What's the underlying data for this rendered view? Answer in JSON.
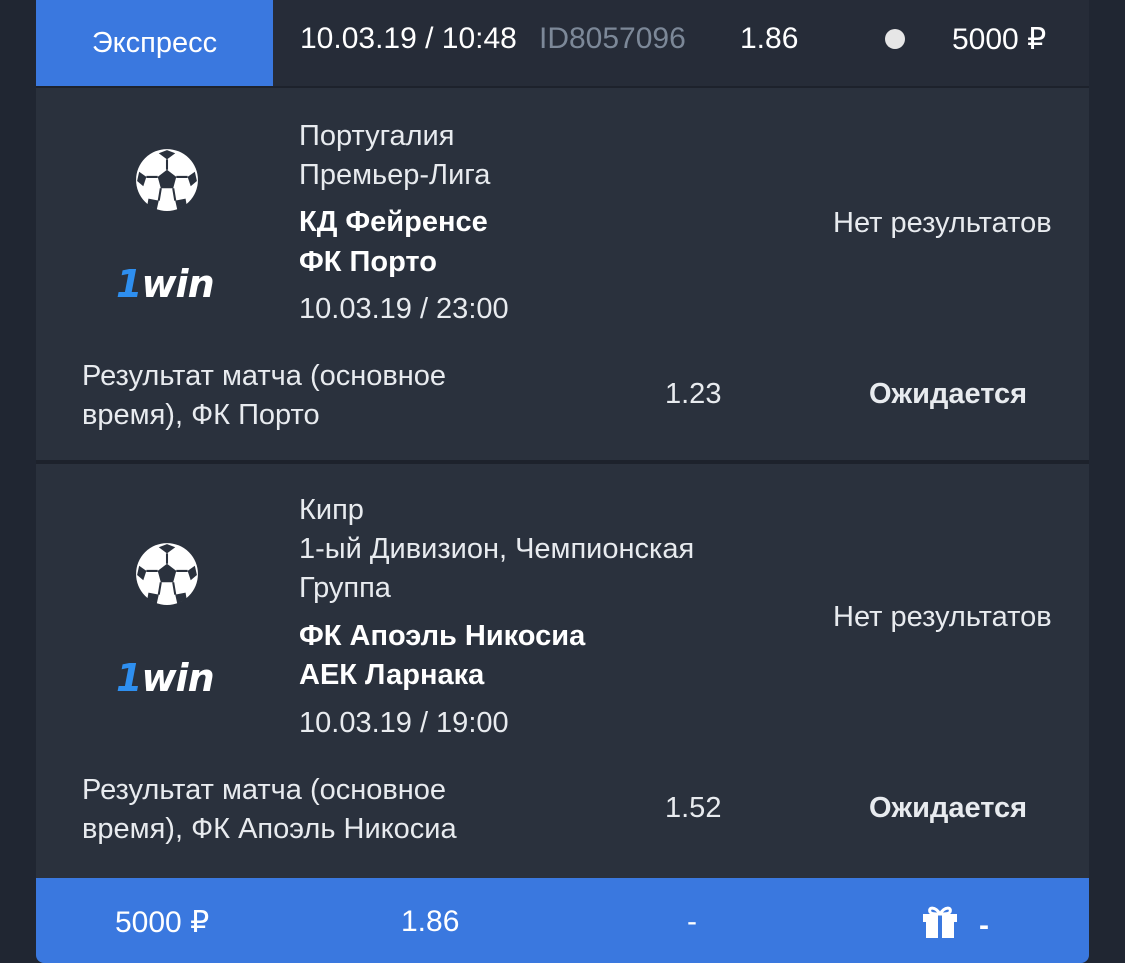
{
  "header": {
    "type_label": "Экспресс",
    "datetime": "10.03.19 / 10:48",
    "bet_id": "ID8057096",
    "coefficient": "1.86",
    "amount": "5000 ₽"
  },
  "events": [
    {
      "country": "Португалия",
      "league_line1": "Премьер-Лига",
      "league_line2": "",
      "team1": "КД Фейренсе",
      "team2": "ФК Порто",
      "datetime": "10.03.19 / 23:00",
      "result": "Нет результатов",
      "market_line1": "Результат матча (основное",
      "market_line2": "время), ФК Порто",
      "odd": "1.23",
      "status": "Ожидается",
      "sport_icon": "soccer-ball-icon",
      "brand_logo": "1win"
    },
    {
      "country": "Кипр",
      "league_line1": "1-ый Дивизион, Чемпионская",
      "league_line2": "Группа",
      "team1": "ФК Апоэль Никосиа",
      "team2": "АЕК Ларнака",
      "datetime": "10.03.19 / 19:00",
      "result": "Нет результатов",
      "market_line1": "Результат матча (основное",
      "market_line2": "время), ФК Апоэль Никосиа",
      "odd": "1.52",
      "status": "Ожидается",
      "sport_icon": "soccer-ball-icon",
      "brand_logo": "1win"
    }
  ],
  "footer": {
    "amount": "5000 ₽",
    "coefficient": "1.86",
    "payout": "-",
    "bonus": "-",
    "gift_icon": "gift-icon"
  },
  "colors": {
    "accent": "#3a78df",
    "card_bg": "#2a313d",
    "page_bg": "#202632",
    "muted_text": "#7c8898",
    "logo_blue": "#2e8ff0"
  }
}
